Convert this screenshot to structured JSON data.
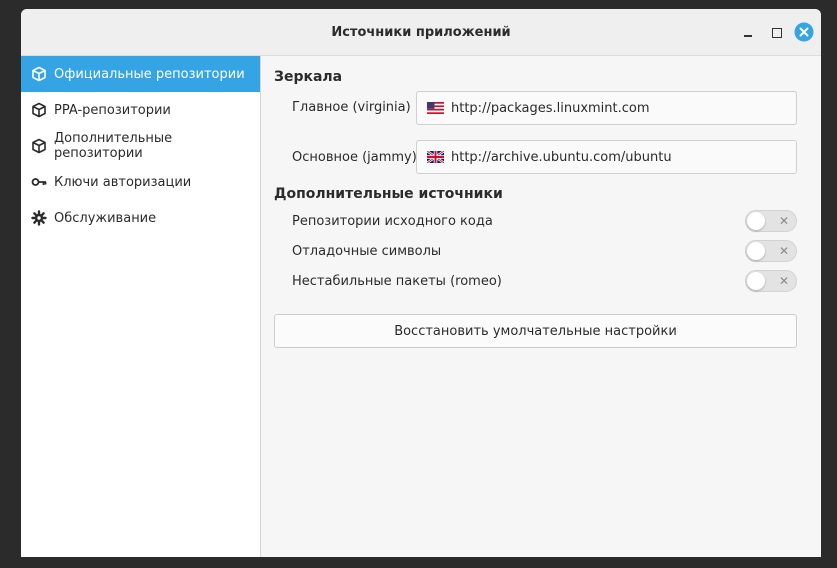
{
  "window": {
    "title": "Источники приложений"
  },
  "sidebar": {
    "items": [
      {
        "label": "Официальные репозитории",
        "icon": "package-icon",
        "active": true
      },
      {
        "label": "PPA-репозитории",
        "icon": "package-icon",
        "active": false
      },
      {
        "label": "Дополнительные репозитории",
        "icon": "package-icon",
        "active": false
      },
      {
        "label": "Ключи авторизации",
        "icon": "key-icon",
        "active": false
      },
      {
        "label": "Обслуживание",
        "icon": "gear-icon",
        "active": false
      }
    ]
  },
  "mirrors": {
    "title": "Зеркала",
    "main": {
      "label": "Главное (virginia)",
      "flag": "us-flag-icon",
      "value": "http://packages.linuxmint.com"
    },
    "base": {
      "label": "Основное (jammy)",
      "flag": "uk-flag-icon",
      "value": "http://archive.ubuntu.com/ubuntu"
    }
  },
  "optional": {
    "title": "Дополнительные источники",
    "toggles": [
      {
        "label": "Репозитории исходного кода",
        "on": false
      },
      {
        "label": "Отладочные символы",
        "on": false
      },
      {
        "label": "Нестабильные пакеты (romeo)",
        "on": false
      }
    ],
    "toggle_off_glyph": "✕"
  },
  "actions": {
    "reset_label": "Восстановить умолчательные настройки"
  },
  "colors": {
    "accent": "#35a4e5",
    "close_button": "#35a4e5"
  }
}
